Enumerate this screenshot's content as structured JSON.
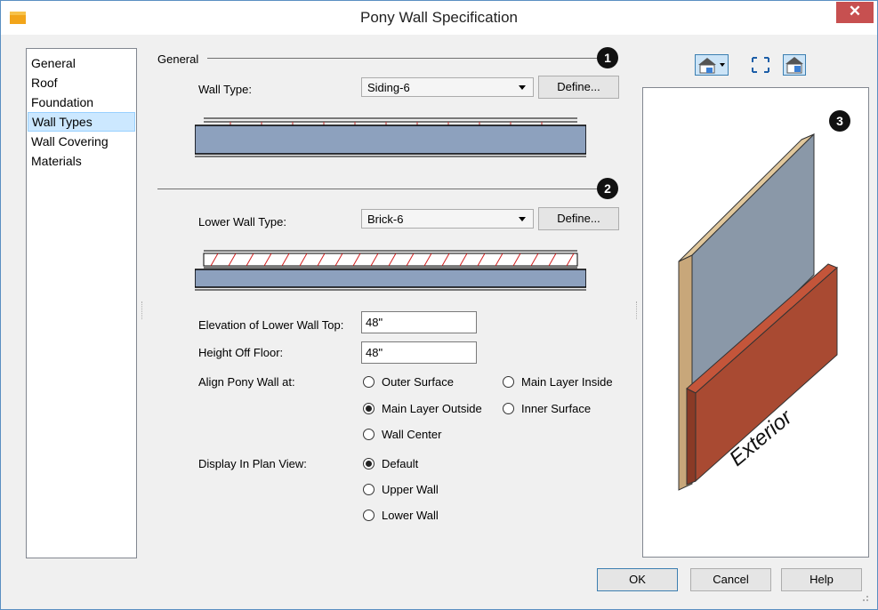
{
  "window": {
    "title": "Pony Wall Specification",
    "close_glyph": "✕"
  },
  "sidebar": {
    "items": [
      {
        "label": "General"
      },
      {
        "label": "Roof"
      },
      {
        "label": "Foundation"
      },
      {
        "label": "Wall Types",
        "selected": true
      },
      {
        "label": "Wall Covering"
      },
      {
        "label": "Materials"
      }
    ]
  },
  "general_group": {
    "label": "General"
  },
  "callouts": [
    "1",
    "2",
    "3"
  ],
  "wall_type": {
    "label": "Wall Type:",
    "value": "Siding-6",
    "define_label": "Define..."
  },
  "lower_wall_type": {
    "label": "Lower Wall Type:",
    "value": "Brick-6",
    "define_label": "Define..."
  },
  "elevation_lower_wall_top": {
    "label": "Elevation of Lower Wall Top:",
    "value": "48\""
  },
  "height_off_floor": {
    "label": "Height Off Floor:",
    "value": "48\""
  },
  "align_pony_wall": {
    "label": "Align Pony Wall at:",
    "options": [
      {
        "label": "Outer Surface",
        "checked": false
      },
      {
        "label": "Main Layer Inside",
        "checked": false
      },
      {
        "label": "Main Layer Outside",
        "checked": true
      },
      {
        "label": "Inner Surface",
        "checked": false
      },
      {
        "label": "Wall Center",
        "checked": false
      }
    ]
  },
  "display_in_plan_view": {
    "label": "Display In Plan View:",
    "options": [
      {
        "label": "Default",
        "checked": true
      },
      {
        "label": "Upper Wall",
        "checked": false
      },
      {
        "label": "Lower Wall",
        "checked": false
      }
    ]
  },
  "preview": {
    "exterior_label": "Exterior",
    "toolbar": [
      "camera-view-dropdown-icon",
      "fill-window-icon",
      "preview-toggle-icon"
    ]
  },
  "colors": {
    "wall_section": "#8da1be",
    "upper_wall_face": "#8a98a8",
    "brick_face": "#a94a32",
    "wall_edge": "#c8a77a",
    "hatch": "#d02020"
  },
  "footer": {
    "ok_label": "OK",
    "cancel_label": "Cancel",
    "help_label": "Help"
  }
}
